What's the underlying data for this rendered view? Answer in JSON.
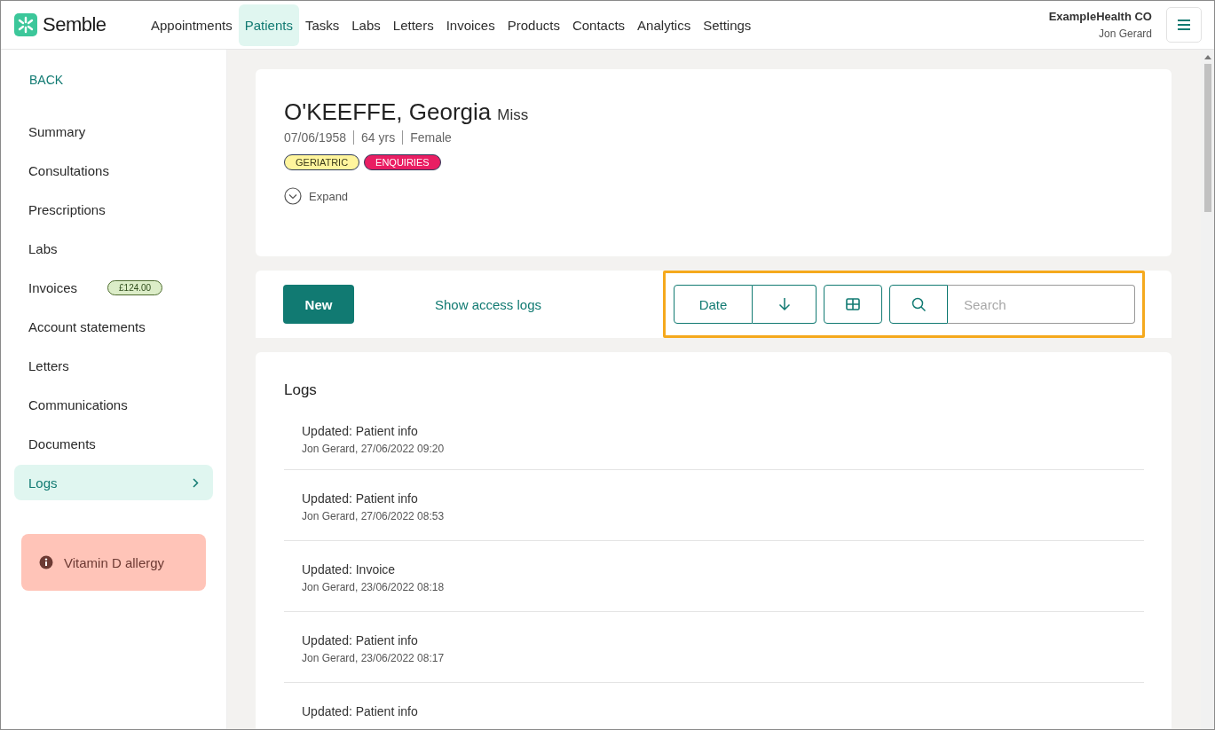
{
  "header": {
    "logo": "Semble",
    "nav": [
      {
        "label": "Appointments",
        "selected": false
      },
      {
        "label": "Patients",
        "selected": true
      },
      {
        "label": "Tasks",
        "selected": false
      },
      {
        "label": "Labs",
        "selected": false
      },
      {
        "label": "Letters",
        "selected": false
      },
      {
        "label": "Invoices",
        "selected": false
      },
      {
        "label": "Products",
        "selected": false
      },
      {
        "label": "Contacts",
        "selected": false
      },
      {
        "label": "Analytics",
        "selected": false
      },
      {
        "label": "Settings",
        "selected": false
      }
    ],
    "organisation": "ExampleHealth CO",
    "user": "Jon Gerard"
  },
  "sidebar": {
    "back": "BACK",
    "items": [
      {
        "label": "Summary",
        "selected": false
      },
      {
        "label": "Consultations",
        "selected": false
      },
      {
        "label": "Prescriptions",
        "selected": false
      },
      {
        "label": "Labs",
        "selected": false
      },
      {
        "label": "Invoices",
        "selected": false,
        "badge": "£124.00"
      },
      {
        "label": "Account statements",
        "selected": false
      },
      {
        "label": "Letters",
        "selected": false
      },
      {
        "label": "Communications",
        "selected": false
      },
      {
        "label": "Documents",
        "selected": false
      },
      {
        "label": "Logs",
        "selected": true
      }
    ],
    "alert": "Vitamin D allergy"
  },
  "patient": {
    "name": "O'KEEFFE, Georgia",
    "title": "Miss",
    "dob": "07/06/1958",
    "age": "64 yrs",
    "sex": "Female",
    "tags": [
      {
        "label": "GERIATRIC",
        "color": "#fff59d"
      },
      {
        "label": "ENQUIRIES",
        "color": "#e91e63"
      }
    ],
    "expand": "Expand"
  },
  "toolbar": {
    "new_button": "New",
    "access_logs_link": "Show access logs",
    "sort": "Date",
    "search": {
      "placeholder": "Search"
    }
  },
  "logs": {
    "title": "Logs",
    "entries": [
      {
        "title": "Updated: Patient info",
        "meta": "Jon Gerard, 27/06/2022 09:20"
      },
      {
        "title": "Updated: Patient info",
        "meta": "Jon Gerard, 27/06/2022 08:53"
      },
      {
        "title": "Updated: Invoice",
        "meta": "Jon Gerard, 23/06/2022 08:18"
      },
      {
        "title": "Updated: Patient info",
        "meta": "Jon Gerard, 23/06/2022 08:17"
      },
      {
        "title": "Updated: Patient info"
      }
    ]
  }
}
